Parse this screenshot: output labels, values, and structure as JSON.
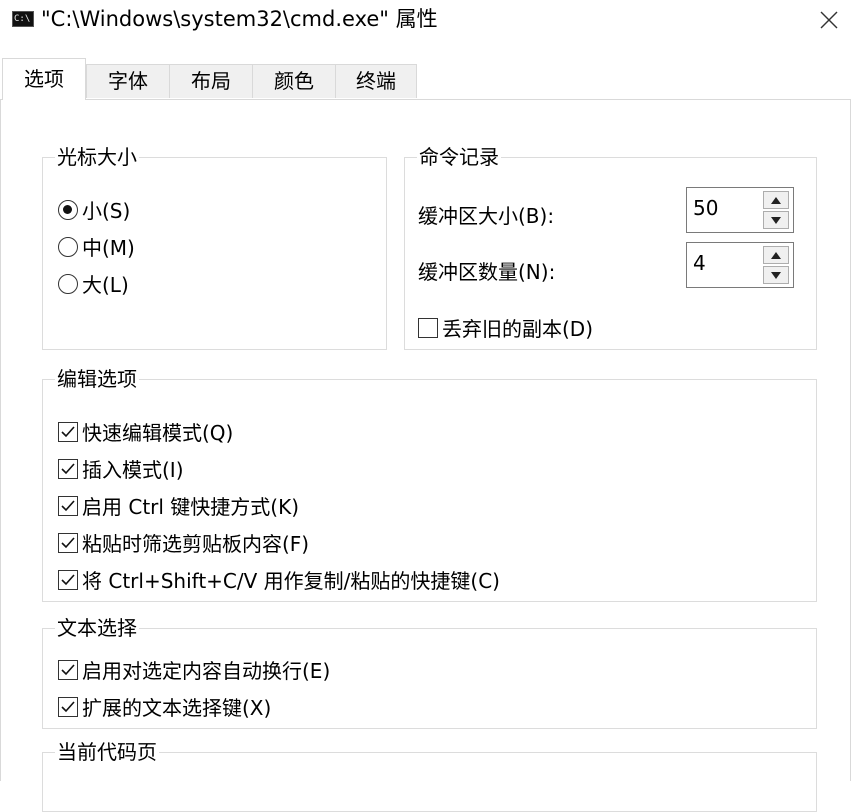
{
  "window": {
    "icon_text": "C:\\",
    "title": "\"C:\\Windows\\system32\\cmd.exe\" 属性",
    "close_glyph": "✕"
  },
  "tabs": [
    {
      "label": "选项",
      "active": true
    },
    {
      "label": "字体",
      "active": false
    },
    {
      "label": "布局",
      "active": false
    },
    {
      "label": "颜色",
      "active": false
    },
    {
      "label": "终端",
      "active": false
    }
  ],
  "cursor_size": {
    "legend": "光标大小",
    "options": [
      {
        "label": "小(S)",
        "checked": true
      },
      {
        "label": "中(M)",
        "checked": false
      },
      {
        "label": "大(L)",
        "checked": false
      }
    ]
  },
  "history": {
    "legend": "命令记录",
    "buffer_size_label": "缓冲区大小(B):",
    "buffer_size_value": "50",
    "buffer_count_label": "缓冲区数量(N):",
    "buffer_count_value": "4",
    "discard_label": "丢弃旧的副本(D)",
    "discard_checked": false
  },
  "edit_options": {
    "legend": "编辑选项",
    "items": [
      {
        "label": "快速编辑模式(Q)",
        "checked": true
      },
      {
        "label": "插入模式(I)",
        "checked": true
      },
      {
        "label": "启用 Ctrl 键快捷方式(K)",
        "checked": true
      },
      {
        "label": "粘贴时筛选剪贴板内容(F)",
        "checked": true
      },
      {
        "label": "将 Ctrl+Shift+C/V 用作复制/粘贴的快捷键(C)",
        "checked": true
      }
    ]
  },
  "text_selection": {
    "legend": "文本选择",
    "items": [
      {
        "label": "启用对选定内容自动换行(E)",
        "checked": true
      },
      {
        "label": "扩展的文本选择键(X)",
        "checked": true
      }
    ]
  },
  "code_page": {
    "legend": "当前代码页"
  }
}
